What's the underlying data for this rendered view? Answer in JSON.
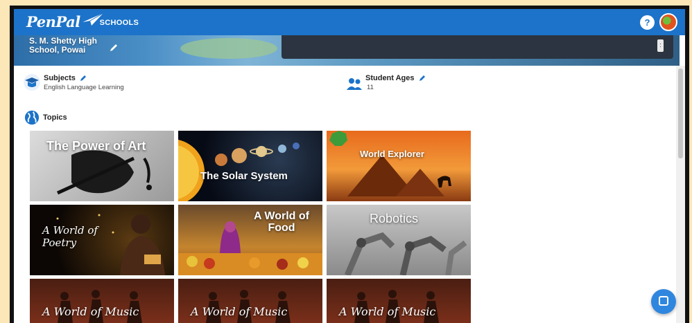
{
  "header": {
    "logo_main": "PenPal",
    "logo_sub": "SCHOOLS",
    "help_label": "?"
  },
  "banner": {
    "school_name": "S. M. Shetty High School, Powai"
  },
  "subjects": {
    "title": "Subjects",
    "value": "English Language Learning"
  },
  "student_ages": {
    "title": "Student Ages",
    "value": "11"
  },
  "topics": {
    "heading": "Topics",
    "tiles": [
      {
        "title": "The Power of Art"
      },
      {
        "title": "The Solar System"
      },
      {
        "title": "World Explorer"
      },
      {
        "title": "A World of Poetry"
      },
      {
        "title": "A World of Food"
      },
      {
        "title": "Robotics"
      },
      {
        "title": "A World of Music"
      },
      {
        "title": "A World of Music"
      },
      {
        "title": "A World of Music"
      }
    ]
  },
  "icons": {
    "help": "help-icon",
    "avatar": "avatar",
    "subjects": "graduation-cap-icon",
    "student_ages": "people-icon",
    "topics": "globe-icon",
    "edit": "pencil-icon",
    "chat": "chat-icon"
  },
  "colors": {
    "header_blue": "#1c73c9",
    "accent_blue": "#2f86df",
    "page_background": "#fbe7b8"
  }
}
